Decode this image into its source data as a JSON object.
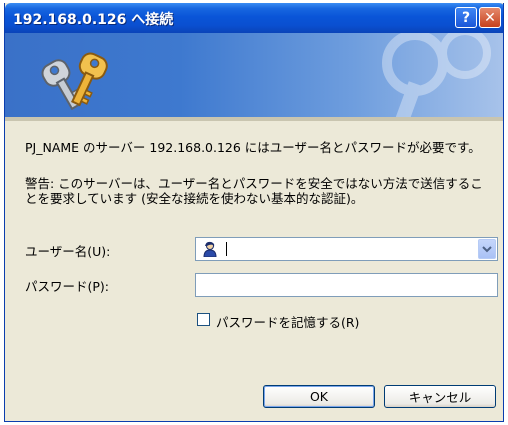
{
  "window": {
    "title": "192.168.0.126 へ接続",
    "help_label": "?",
    "close_label": "✕"
  },
  "message": {
    "line1": "PJ_NAME のサーバー 192.168.0.126 にはユーザー名とパスワードが必要です。",
    "warning": "警告: このサーバーは、ユーザー名とパスワードを安全ではない方法で送信することを要求しています (安全な接続を使わない基本的な認証)。"
  },
  "form": {
    "username_label": "ユーザー名(U):",
    "password_label": "パスワード(P):",
    "username_value": "",
    "password_value": "",
    "remember_label": "パスワードを記憶する(R)",
    "remember_checked": false
  },
  "buttons": {
    "ok_label": "OK",
    "cancel_label": "キャンセル"
  },
  "icons": {
    "banner": "keys-icon",
    "user": "user-icon",
    "dropdown": "chevron-down-icon"
  },
  "colors": {
    "titlebar": "#0a55d8",
    "dialog_bg": "#ece9d8",
    "close_button": "#c7411e"
  }
}
